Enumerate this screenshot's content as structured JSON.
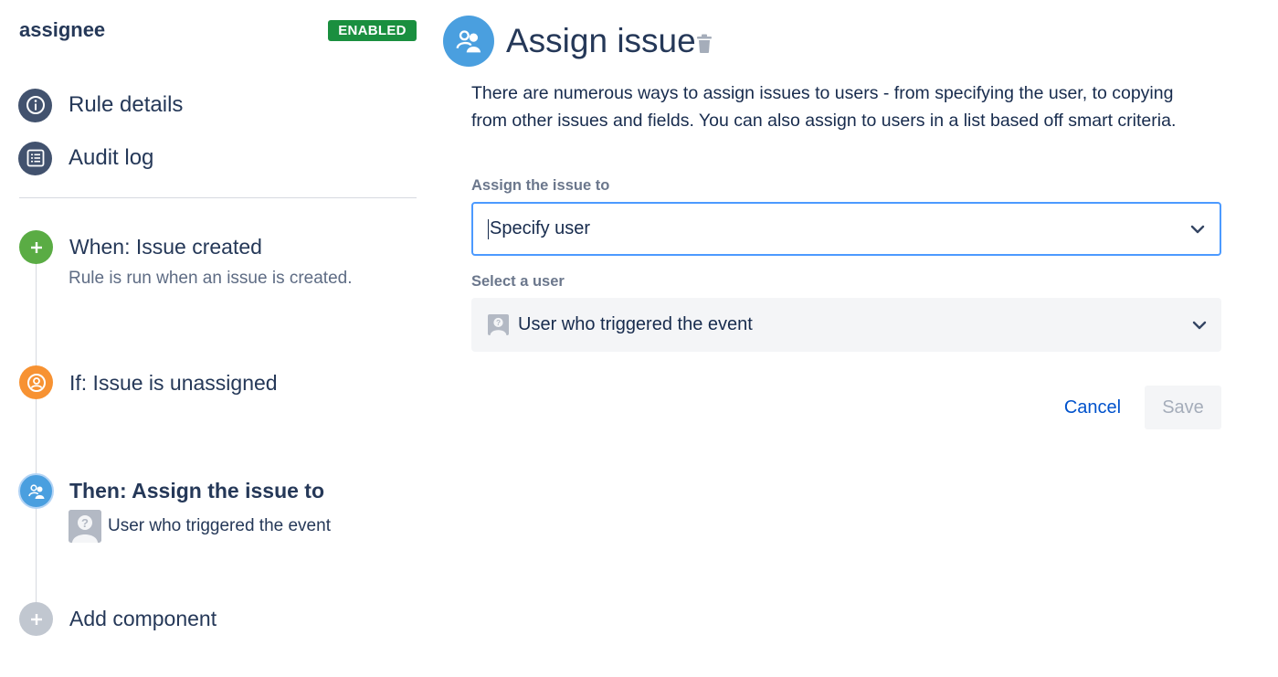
{
  "sidebar": {
    "rule_name": "assignee",
    "status_badge": "ENABLED",
    "nav": [
      {
        "label": "Rule details",
        "icon": "info-icon"
      },
      {
        "label": "Audit log",
        "icon": "list-icon"
      }
    ],
    "steps": {
      "trigger": {
        "title": "When: Issue created",
        "description": "Rule is run when an issue is created.",
        "icon": "plus-icon",
        "color": "#5aac44"
      },
      "condition": {
        "title": "If: Issue is unassigned",
        "icon": "user-circle-icon",
        "color": "#f79232"
      },
      "action": {
        "title": "Then: Assign the issue to",
        "subtitle": "User who triggered the event",
        "icon": "assign-users-icon",
        "color": "#4a9fdf"
      },
      "add": {
        "title": "Add component",
        "icon": "plus-icon",
        "color": "#c1c7d0"
      }
    }
  },
  "main": {
    "title": "Assign issue",
    "description": "There are numerous ways to assign issues to users - from specifying the user, to copying from other issues and fields. You can also assign to users in a list based off smart criteria.",
    "assign_field": {
      "label": "Assign the issue to",
      "value": "Specify user"
    },
    "user_field": {
      "label": "Select a user",
      "value": "User who triggered the event"
    },
    "buttons": {
      "cancel": "Cancel",
      "save": "Save"
    }
  },
  "colors": {
    "enabled_badge": "#1a8f3f",
    "focus_border": "#4c9aff",
    "link": "#0052cc",
    "header_icon": "#4a9fdf"
  }
}
